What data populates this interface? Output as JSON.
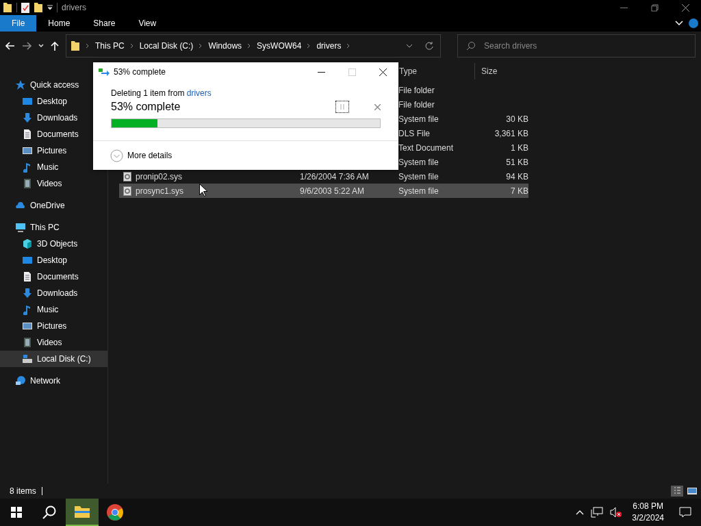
{
  "window": {
    "title": "drivers"
  },
  "ribbon": {
    "tabs": [
      {
        "label": "File",
        "selected": true
      },
      {
        "label": "Home",
        "selected": false
      },
      {
        "label": "Share",
        "selected": false
      },
      {
        "label": "View",
        "selected": false
      }
    ]
  },
  "address": {
    "crumbs": [
      "This PC",
      "Local Disk (C:)",
      "Windows",
      "SysWOW64",
      "drivers"
    ],
    "search_placeholder": "Search drivers"
  },
  "sidebar": {
    "items": [
      {
        "label": "Quick access",
        "kind": "star",
        "selected": false,
        "children": [
          {
            "label": "Desktop",
            "kind": "desktop",
            "selected": false
          },
          {
            "label": "Downloads",
            "kind": "download",
            "selected": false
          },
          {
            "label": "Documents",
            "kind": "document",
            "selected": false
          },
          {
            "label": "Pictures",
            "kind": "picture",
            "selected": false
          },
          {
            "label": "Music",
            "kind": "music",
            "selected": false
          },
          {
            "label": "Videos",
            "kind": "video",
            "selected": false
          }
        ]
      },
      {
        "label": "OneDrive",
        "kind": "cloud",
        "selected": false
      },
      {
        "label": "This PC",
        "kind": "pc",
        "selected": false,
        "children": [
          {
            "label": "3D Objects",
            "kind": "cube",
            "selected": false
          },
          {
            "label": "Desktop",
            "kind": "desktop",
            "selected": false
          },
          {
            "label": "Documents",
            "kind": "document",
            "selected": false
          },
          {
            "label": "Downloads",
            "kind": "download",
            "selected": false
          },
          {
            "label": "Music",
            "kind": "music",
            "selected": false
          },
          {
            "label": "Pictures",
            "kind": "picture",
            "selected": false
          },
          {
            "label": "Videos",
            "kind": "video",
            "selected": false
          },
          {
            "label": "Local Disk (C:)",
            "kind": "disk",
            "selected": true
          }
        ]
      },
      {
        "label": "Network",
        "kind": "network",
        "selected": false
      }
    ]
  },
  "file_list": {
    "columns": [
      "Type",
      "Size"
    ],
    "rows": [
      {
        "type": "File folder",
        "selected": false
      },
      {
        "type": "File folder",
        "selected": false
      },
      {
        "type": "System file",
        "size": "30 KB",
        "selected": false
      },
      {
        "type": "DLS File",
        "size": "3,361 KB",
        "selected": false
      },
      {
        "type": "Text Document",
        "size": "1 KB",
        "selected": false
      },
      {
        "type": "System file",
        "size": "51 KB",
        "selected": false
      },
      {
        "name": "pronip02.sys",
        "date": "1/26/2004 7:36 AM",
        "type": "System file",
        "size": "94 KB",
        "selected": false
      },
      {
        "name": "prosync1.sys",
        "date": "9/6/2003 5:22 AM",
        "type": "System file",
        "size": "7 KB",
        "selected": true
      }
    ]
  },
  "dialog": {
    "title": "53% complete",
    "message": "Deleting 1 item from",
    "source": "drivers",
    "progress_label": "53% complete",
    "level": 0.17,
    "details": "More details"
  },
  "status_bar": {
    "count": "8 items"
  },
  "taskbar": {
    "time": "6:08 PM",
    "date": "3/2/2024"
  }
}
